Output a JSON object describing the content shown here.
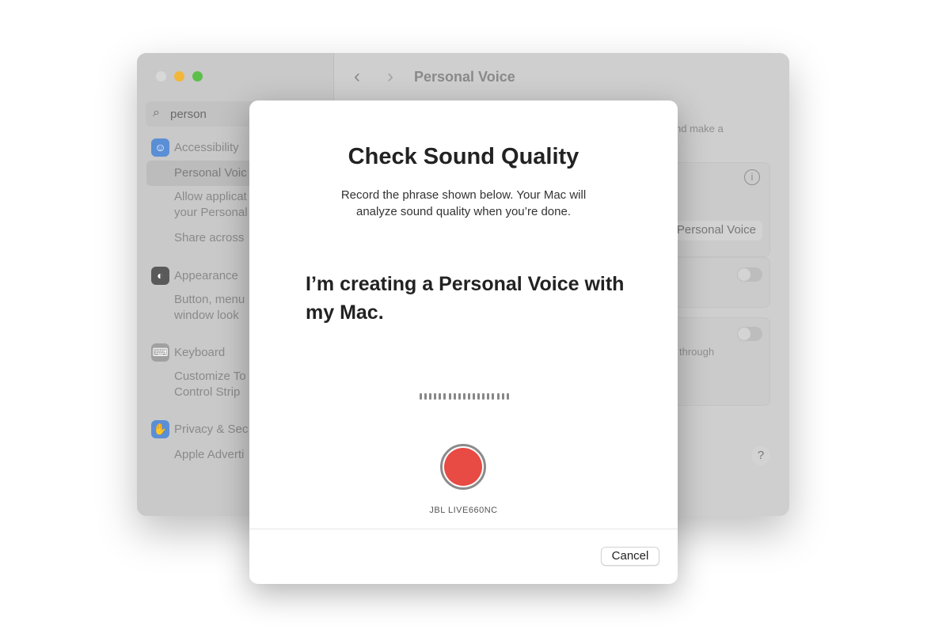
{
  "window": {
    "search": {
      "value": "person",
      "icon": "search-icon"
    },
    "sidebar": {
      "sections": [
        {
          "title": "Accessibility",
          "icon": "accessibility-icon",
          "color": "#5a8fd6",
          "items": [
            "Personal Voice",
            "Allow applications to request to use your Personal Voice",
            "Share across devices"
          ]
        },
        {
          "title": "Appearance",
          "icon": "appearance-icon",
          "color": "#5a5a5a",
          "items": [
            "Button, menu, and window look"
          ]
        },
        {
          "title": "Keyboard",
          "icon": "keyboard-icon",
          "color": "#9a9a9a",
          "items": [
            "Customize Touch Bar and Control Strip"
          ]
        },
        {
          "title": "Privacy & Security",
          "icon": "hand-icon",
          "color": "#5a8fd6",
          "items": [
            "Apple Advertising"
          ]
        }
      ],
      "visible": {
        "acc": "Accessibility",
        "pv": "Personal Voic",
        "allow1": "Allow applicat",
        "allow2": "your Personal",
        "share": "Share across",
        "app": "Appearance",
        "app1": "Button, menu",
        "app2": "window look",
        "kb": "Keyboard",
        "kb1": "Customize To",
        "kb2": "Control Strip",
        "priv": "Privacy & Sec",
        "priv1": "Apple Adverti"
      }
    },
    "header": {
      "title": "Personal Voice",
      "back": "‹",
      "forward": "›"
    },
    "main": {
      "desc_fragment": "nd make a",
      "button_fragment": "Personal Voice",
      "through_fragment": "through",
      "info": "i",
      "help": "?"
    }
  },
  "dialog": {
    "title": "Check Sound Quality",
    "subtitle_line1": "Record the phrase shown below. Your Mac will",
    "subtitle_line2": "analyze sound quality when you’re done.",
    "phrase": "I’m creating a Personal Voice with my Mac.",
    "level_bars": 19,
    "record_color": "#e84a44",
    "device": "JBL LIVE660NC",
    "cancel": "Cancel"
  }
}
